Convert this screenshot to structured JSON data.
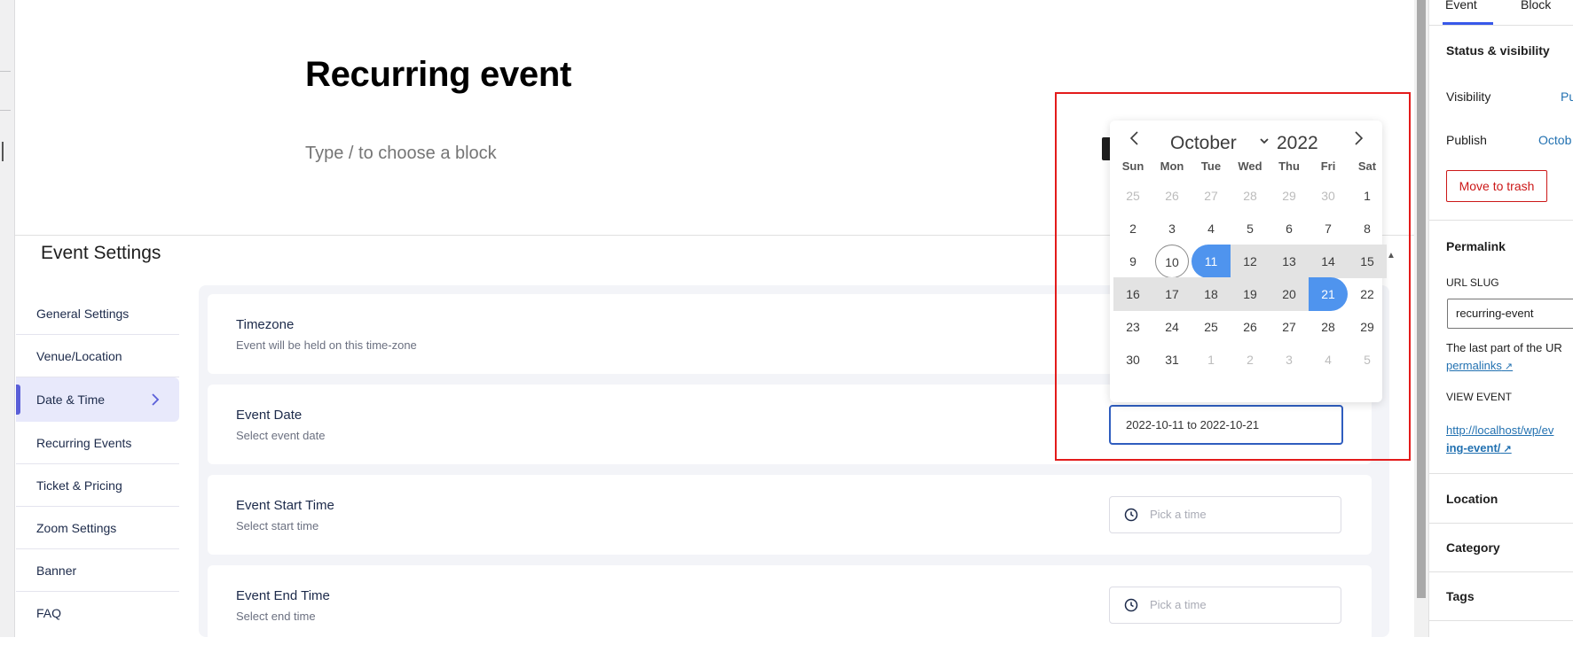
{
  "editor": {
    "post_title": "Recurring event",
    "block_placeholder": "Type / to choose a block"
  },
  "meta_box": {
    "title": "Event Settings",
    "nav": [
      {
        "label": "General Settings"
      },
      {
        "label": "Venue/Location"
      },
      {
        "label": "Date & Time",
        "active": true
      },
      {
        "label": "Recurring Events"
      },
      {
        "label": "Ticket & Pricing"
      },
      {
        "label": "Zoom Settings"
      },
      {
        "label": "Banner"
      },
      {
        "label": "FAQ"
      }
    ],
    "fields": [
      {
        "title": "Timezone",
        "subtitle": "Event will be held on this time-zone"
      },
      {
        "title": "Event Date",
        "subtitle": "Select event date",
        "value": "2022-10-11 to 2022-10-21"
      },
      {
        "title": "Event Start Time",
        "subtitle": "Select start time",
        "placeholder": "Pick a time"
      },
      {
        "title": "Event End Time",
        "subtitle": "Select end time",
        "placeholder": "Pick a time"
      }
    ]
  },
  "calendar": {
    "month": "October",
    "year": "2022",
    "weekdays": [
      "Sun",
      "Mon",
      "Tue",
      "Wed",
      "Thu",
      "Fri",
      "Sat"
    ],
    "weeks": [
      [
        {
          "d": "25",
          "m": true
        },
        {
          "d": "26",
          "m": true
        },
        {
          "d": "27",
          "m": true
        },
        {
          "d": "28",
          "m": true
        },
        {
          "d": "29",
          "m": true
        },
        {
          "d": "30",
          "m": true
        },
        {
          "d": "1"
        }
      ],
      [
        {
          "d": "2"
        },
        {
          "d": "3"
        },
        {
          "d": "4"
        },
        {
          "d": "5"
        },
        {
          "d": "6"
        },
        {
          "d": "7"
        },
        {
          "d": "8"
        }
      ],
      [
        {
          "d": "9"
        },
        {
          "d": "10",
          "today": true
        },
        {
          "d": "11",
          "sel": "start"
        },
        {
          "d": "12",
          "r": true
        },
        {
          "d": "13",
          "r": true
        },
        {
          "d": "14",
          "r": true
        },
        {
          "d": "15",
          "r": true
        }
      ],
      [
        {
          "d": "16",
          "r": true
        },
        {
          "d": "17",
          "r": true
        },
        {
          "d": "18",
          "r": true
        },
        {
          "d": "19",
          "r": true
        },
        {
          "d": "20",
          "r": true
        },
        {
          "d": "21",
          "sel": "end"
        },
        {
          "d": "22"
        }
      ],
      [
        {
          "d": "23"
        },
        {
          "d": "24"
        },
        {
          "d": "25"
        },
        {
          "d": "26"
        },
        {
          "d": "27"
        },
        {
          "d": "28"
        },
        {
          "d": "29"
        }
      ],
      [
        {
          "d": "30"
        },
        {
          "d": "31"
        },
        {
          "d": "1",
          "m": true
        },
        {
          "d": "2",
          "m": true
        },
        {
          "d": "3",
          "m": true
        },
        {
          "d": "4",
          "m": true
        },
        {
          "d": "5",
          "m": true
        }
      ]
    ],
    "selection_color": "#4f94ee",
    "range_color": "#e3e3e3"
  },
  "sidebar": {
    "tabs": {
      "event": "Event",
      "block": "Block"
    },
    "status_heading": "Status & visibility",
    "visibility_label": "Visibility",
    "visibility_value": "Pu",
    "publish_label": "Publish",
    "publish_value": "Octob",
    "trash_button": "Move to trash",
    "permalink_heading": "Permalink",
    "url_slug_label": "URL SLUG",
    "url_slug_value": "recurring-event",
    "slug_help": "The last part of the UR",
    "slug_help_link": "permalinks",
    "view_event_label": "VIEW EVENT",
    "view_event_url_line1": "http://localhost/wp/ev",
    "view_event_url_line2": "ing-event/",
    "location_heading": "Location",
    "category_heading": "Category",
    "tags_heading": "Tags"
  },
  "colors": {
    "accent": "#3858e9",
    "highlight_box": "#e31b1b",
    "link": "#2271b1",
    "trash": "#cc1818"
  }
}
